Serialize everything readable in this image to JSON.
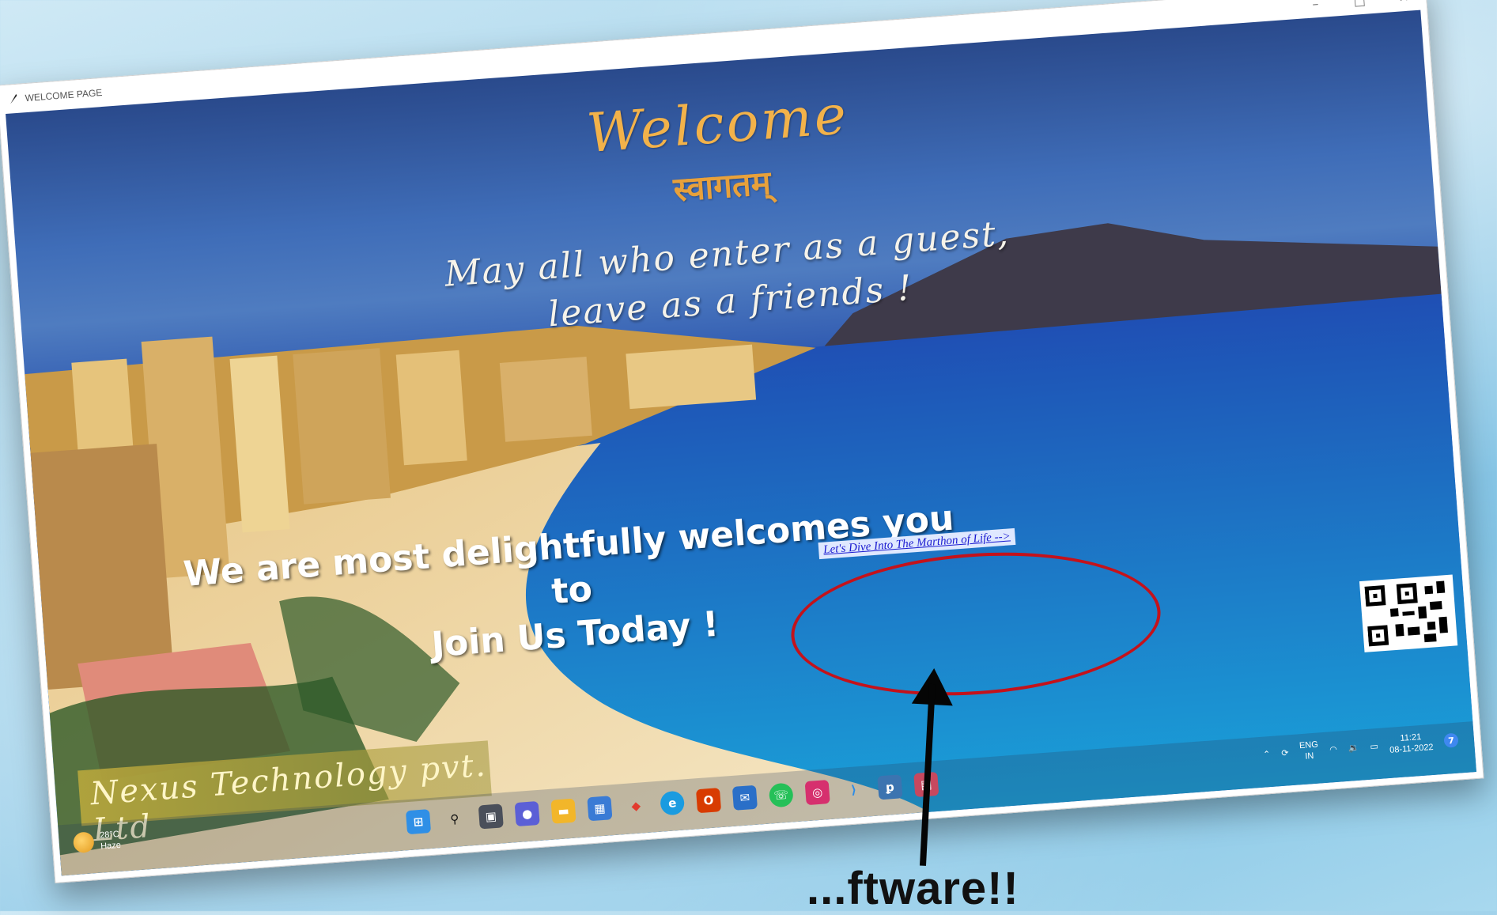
{
  "window": {
    "title": "WELCOME PAGE",
    "minimize_glyph": "–",
    "maximize_glyph": "□",
    "close_glyph": "✕"
  },
  "page": {
    "heading": "Welcome",
    "heading_hindi": "स्वागतम्",
    "quote_line1": "May all who enter as a guest,",
    "quote_line2": "leave as a friends !",
    "delight_line1": "We are most delightfully welcomes you to",
    "delight_line2": "Join Us Today !",
    "link_text": "Let's Dive Into The Marthon of Life -->",
    "company": "Nexus Technology pvt. Ltd"
  },
  "taskbar": {
    "weather_temp": "28°C",
    "weather_desc": "Haze",
    "lang_top": "ENG",
    "lang_bottom": "IN",
    "time": "11:21",
    "date": "08-11-2022",
    "notification_count": "7",
    "icons": [
      "windows-start-icon",
      "search-icon",
      "task-view-icon",
      "chat-icon",
      "file-explorer-icon",
      "store-icon",
      "diamond-app-icon",
      "browser-icon",
      "office-icon",
      "mail-icon",
      "whatsapp-icon",
      "instagram-icon",
      "vscode-icon",
      "python-icon",
      "app-window-icon"
    ]
  },
  "annotation": {
    "caption": "...ftware!!",
    "highlight_color": "#c4121b"
  }
}
